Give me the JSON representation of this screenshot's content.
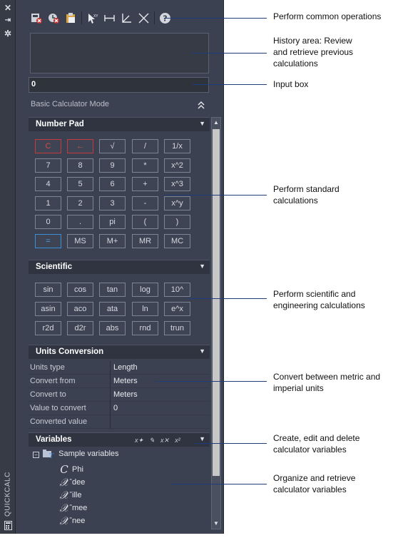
{
  "palette_title": "QUICKCALC",
  "input": {
    "value": "0"
  },
  "mode_label": "Basic Calculator Mode",
  "sections": {
    "number_pad": "Number Pad",
    "scientific": "Scientific",
    "units": "Units Conversion",
    "variables": "Variables"
  },
  "number_pad": [
    [
      "C",
      "←",
      "√",
      "/",
      "1/x"
    ],
    [
      "7",
      "8",
      "9",
      "*",
      "x^2"
    ],
    [
      "4",
      "5",
      "6",
      "+",
      "x^3"
    ],
    [
      "1",
      "2",
      "3",
      "-",
      "x^y"
    ],
    [
      "0",
      ".",
      "pi",
      "(",
      ")"
    ],
    [
      "=",
      "MS",
      "M+",
      "MR",
      "MC"
    ]
  ],
  "scientific": [
    [
      "sin",
      "cos",
      "tan",
      "log",
      "10^"
    ],
    [
      "asin",
      "aco",
      "ata",
      "ln",
      "e^x"
    ],
    [
      "r2d",
      "d2r",
      "abs",
      "rnd",
      "trun"
    ]
  ],
  "units": [
    {
      "key": "Units type",
      "value": "Length"
    },
    {
      "key": "Convert from",
      "value": "Meters"
    },
    {
      "key": "Convert to",
      "value": "Meters"
    },
    {
      "key": "Value to convert",
      "value": "0"
    },
    {
      "key": "Converted value",
      "value": ""
    }
  ],
  "variables": {
    "root": "Sample variables",
    "items": [
      {
        "glyph": "C",
        "name": "Phi"
      },
      {
        "glyph": "X",
        "name": "dee"
      },
      {
        "glyph": "X",
        "name": "ille"
      },
      {
        "glyph": "X",
        "name": "mee"
      },
      {
        "glyph": "X",
        "name": "nee"
      }
    ]
  },
  "callouts": [
    {
      "text": "Perform common operations"
    },
    {
      "text": "History area: Review and retrieve previous calculations"
    },
    {
      "text": "Input box"
    },
    {
      "text": "Perform standard calculations"
    },
    {
      "text": "Perform scientific and engineering calculations"
    },
    {
      "text": "Convert between metric and imperial units"
    },
    {
      "text": "Create, edit and delete calculator variables"
    },
    {
      "text": "Organize and retrieve calculator variables"
    }
  ],
  "colors": {
    "panel": "#3b4150",
    "accent_red": "#c33b3b",
    "accent_blue": "#3a8fd6",
    "callout_line": "#1f3d7a"
  }
}
